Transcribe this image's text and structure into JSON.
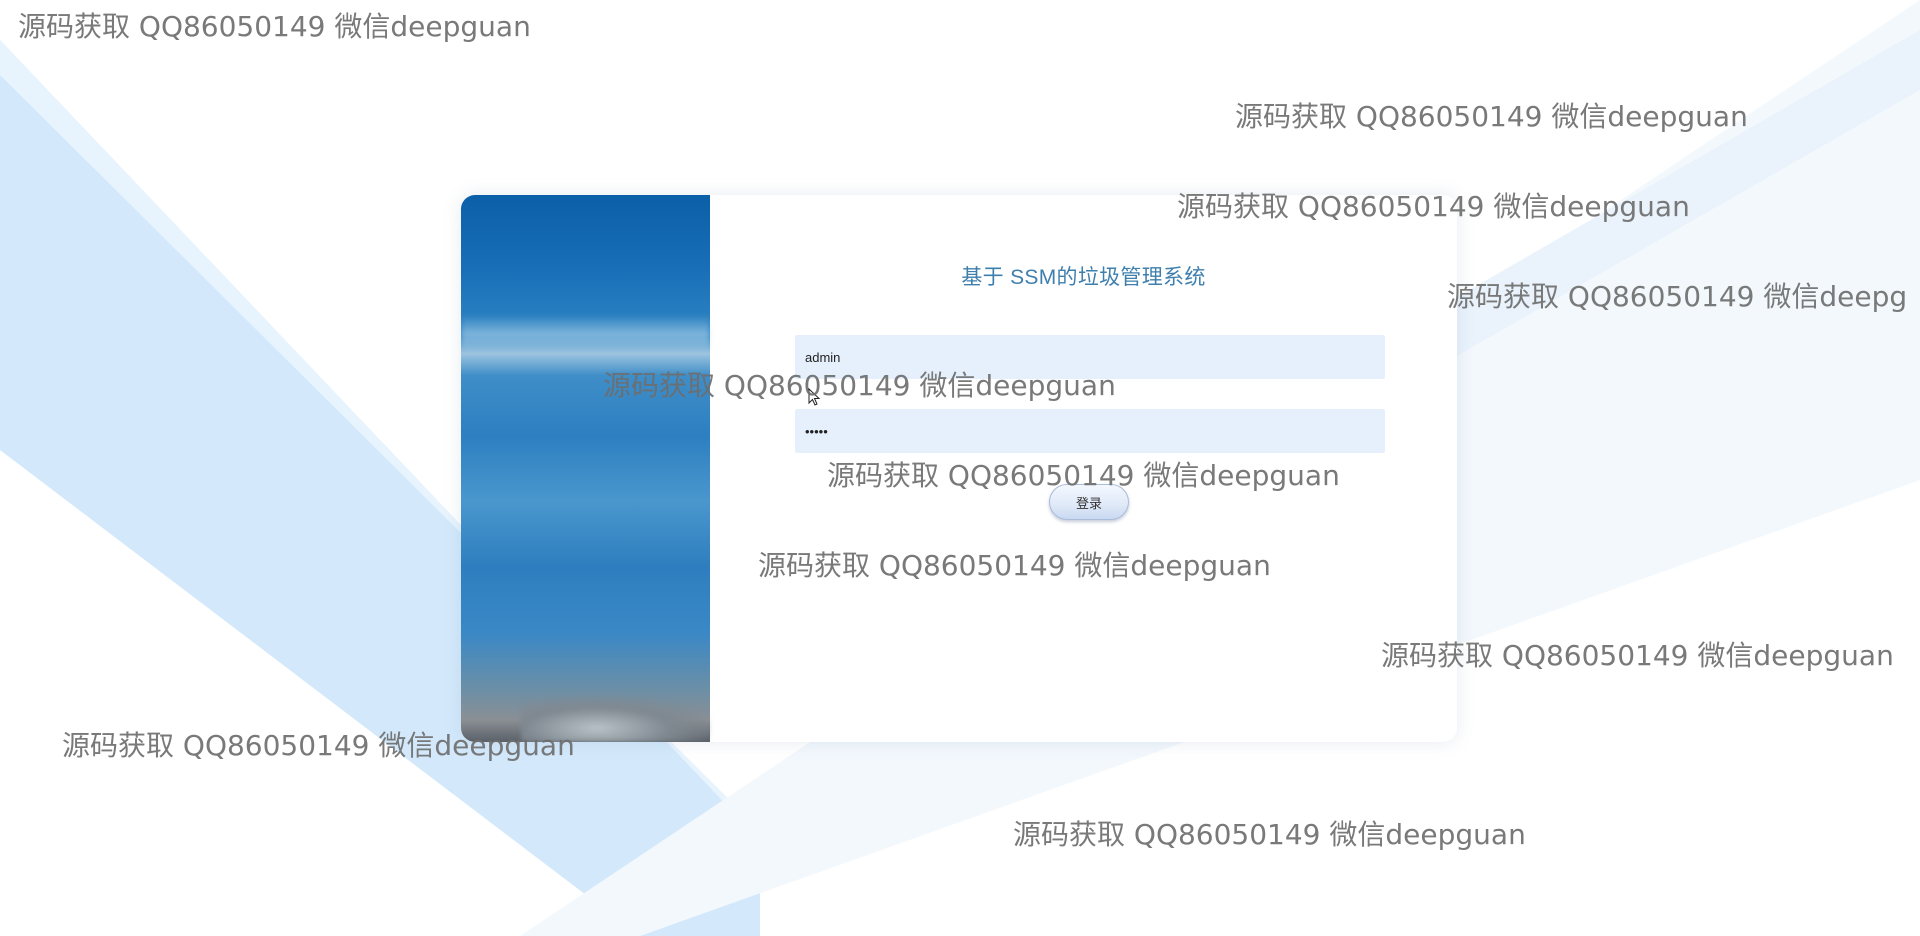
{
  "login": {
    "title": "基于 SSM的垃圾管理系统",
    "username_value": "admin",
    "password_value": "admin",
    "login_label": "登录"
  },
  "watermarks": {
    "wm1": "源码获取 QQ86050149 微信deepguan",
    "wm2": "源码获取 QQ86050149 微信deepguan",
    "wm3": "源码获取 QQ86050149 微信deepguan",
    "wm4": "源码获取 QQ86050149 微信deepg",
    "wm5": "源码获取 QQ86050149 微信deepguan",
    "wm6": "源码获取 QQ86050149 微信deepguan",
    "wm7": "源码获取 QQ86050149 微信deepguan",
    "wm8": "源码获取 QQ86050149 微信deepguan",
    "wm9": "源码获取 QQ86050149 微信deepguan",
    "wm10": "源码获取 QQ86050149 微信deepguan"
  },
  "colors": {
    "accent": "#3e7fae",
    "input_bg": "#e6f0fd",
    "bg_stripe": "#d2e9fb"
  }
}
